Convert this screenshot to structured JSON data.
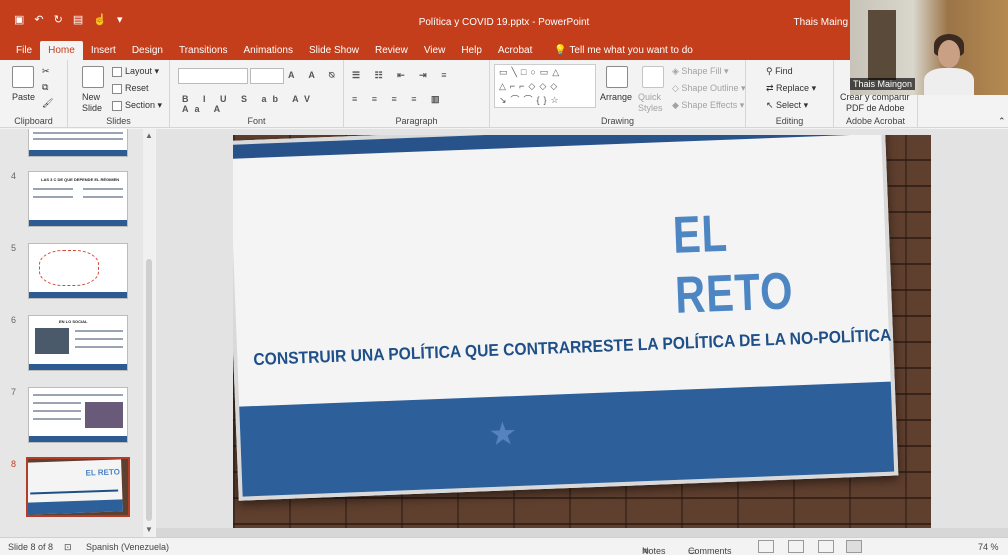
{
  "title_bar": {
    "document_title": "Política y COVID 19.pptx  -  PowerPoint",
    "user": "Thais Maing",
    "qat_icons": [
      "save-icon",
      "undo-icon",
      "redo-icon",
      "start-slideshow-icon",
      "touch-mode-icon",
      "customize-icon"
    ]
  },
  "tabs": {
    "items": [
      "File",
      "Home",
      "Insert",
      "Design",
      "Transitions",
      "Animations",
      "Slide Show",
      "Review",
      "View",
      "Help",
      "Acrobat"
    ],
    "active": "Home",
    "tell_me": "Tell me what you want to do"
  },
  "ribbon": {
    "clipboard": {
      "paste": "Paste",
      "label": "Clipboard"
    },
    "slides": {
      "new_slide": "New Slide",
      "layout": "Layout",
      "reset": "Reset",
      "section": "Section",
      "label": "Slides"
    },
    "font": {
      "label": "Font"
    },
    "paragraph": {
      "label": "Paragraph"
    },
    "drawing": {
      "arrange": "Arrange",
      "quick_styles": "Quick Styles",
      "shape_fill": "Shape Fill",
      "shape_outline": "Shape Outline",
      "shape_effects": "Shape Effects",
      "label": "Drawing"
    },
    "editing": {
      "find": "Find",
      "replace": "Replace",
      "select": "Select",
      "label": "Editing"
    },
    "acrobat": {
      "create": "Crear y compartir",
      "create2": "PDF de Adobe",
      "label": "Adobe Acrobat"
    }
  },
  "thumbnails": [
    {
      "num": "4",
      "caption": "LAS 3 C DE QUE DEPENDE EL RÉGIMEN"
    },
    {
      "num": "5",
      "caption": ""
    },
    {
      "num": "6",
      "caption": "EN LO SOCIAL"
    },
    {
      "num": "7",
      "caption": ""
    },
    {
      "num": "8",
      "caption": "EL RETO"
    }
  ],
  "slide": {
    "heading": "EL RETO",
    "subtitle": "CONSTRUIR UNA POLÍTICA QUE CONTRARRESTE  LA POLÍTICA DE LA NO-POLÍTICA"
  },
  "status_bar": {
    "slide_position": "Slide 8 of 8",
    "language": "Spanish (Venezuela)",
    "notes": "Notes",
    "comments": "Comments",
    "zoom": "74 %"
  },
  "webcam": {
    "name": "Thais Maingon"
  },
  "colors": {
    "accent": "#c43e1c",
    "slide_blue": "#2d5f9a",
    "title_blue": "#4d86c3"
  }
}
